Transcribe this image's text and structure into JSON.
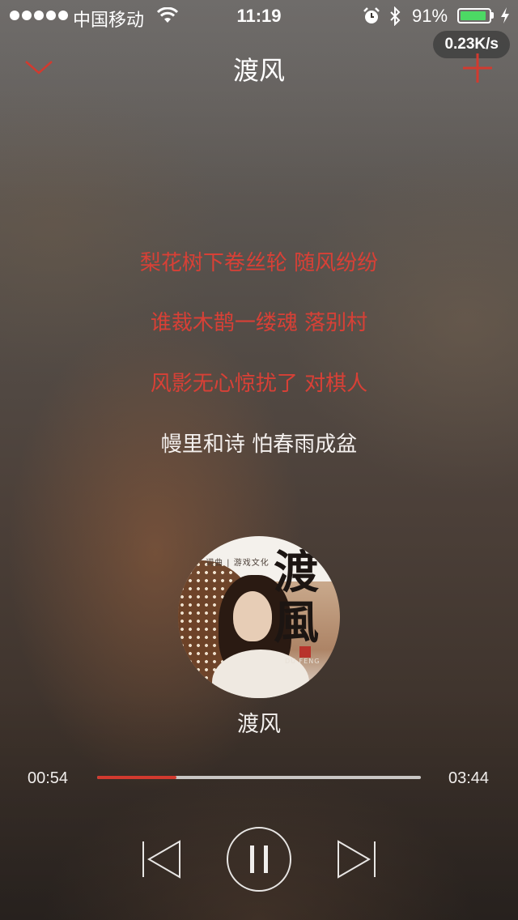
{
  "status_bar": {
    "carrier": "中国移动",
    "time": "11:19",
    "battery_percent": "91%",
    "battery_level": 0.91,
    "icons": [
      "signal-dots",
      "wifi-icon",
      "alarm-icon",
      "bluetooth-icon",
      "battery-icon",
      "charging-bolt-icon"
    ]
  },
  "network_speed": "0.23K/s",
  "header": {
    "title": "渡风",
    "back_icon": "chevron-down-icon",
    "add_icon": "plus-icon"
  },
  "lyrics": [
    {
      "text": "梨花树下卷丝轮 随风纷纷",
      "state": "played"
    },
    {
      "text": "谁裁木鹊一缕魂 落别村",
      "state": "played"
    },
    {
      "text": "风影无心惊扰了 对棋人",
      "state": "played"
    },
    {
      "text": "幔里和诗 怕春雨成盆",
      "state": "current"
    }
  ],
  "album": {
    "title_art": "渡風",
    "credit": "词曲 | 游戏文化",
    "subtitle_art": "DU FENG"
  },
  "song_name": "渡风",
  "playback": {
    "current_time": "00:54",
    "total_time": "03:44",
    "progress": 0.245
  },
  "colors": {
    "accent": "#d23a2f",
    "lyric_played": "#d84036",
    "lyric_current": "#f4f0ee",
    "battery": "#4cd964"
  }
}
